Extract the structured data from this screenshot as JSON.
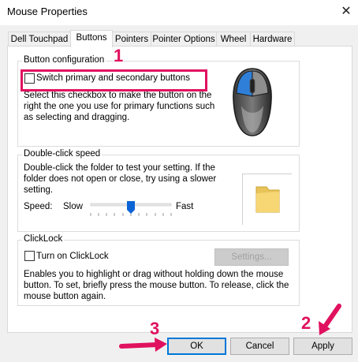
{
  "window": {
    "title": "Mouse Properties",
    "close_glyph": "✕"
  },
  "tabs": [
    {
      "label": "Dell Touchpad"
    },
    {
      "label": "Buttons"
    },
    {
      "label": "Pointers"
    },
    {
      "label": "Pointer Options"
    },
    {
      "label": "Wheel"
    },
    {
      "label": "Hardware"
    }
  ],
  "active_tab": "Buttons",
  "button_config": {
    "legend": "Button configuration",
    "switch_label": "Switch primary and secondary buttons",
    "switch_checked": false,
    "description": [
      "Select this checkbox to make the button on the",
      "right the one you use for primary functions such",
      "as selecting and dragging."
    ]
  },
  "double_click": {
    "legend": "Double-click speed",
    "description": [
      "Double-click the folder to test your setting. If the",
      "folder does not open or close, try using a slower",
      "setting."
    ],
    "speed_label": "Speed:",
    "slow_label": "Slow",
    "fast_label": "Fast",
    "speed_value": 0.5
  },
  "clicklock": {
    "legend": "ClickLock",
    "turn_on_label": "Turn on ClickLock",
    "turn_on_checked": false,
    "settings_label": "Settings...",
    "description": [
      "Enables you to highlight or drag without holding down the mouse",
      "button. To set, briefly press the mouse button. To release, click the",
      "mouse button again."
    ]
  },
  "footer": {
    "ok_label": "OK",
    "cancel_label": "Cancel",
    "apply_label": "Apply"
  },
  "annotations": {
    "step1": "1",
    "step2": "2",
    "step3": "3"
  },
  "colors": {
    "annotation": "#e0115f",
    "accent": "#0078d7",
    "slider_thumb": "#0a64d6"
  }
}
